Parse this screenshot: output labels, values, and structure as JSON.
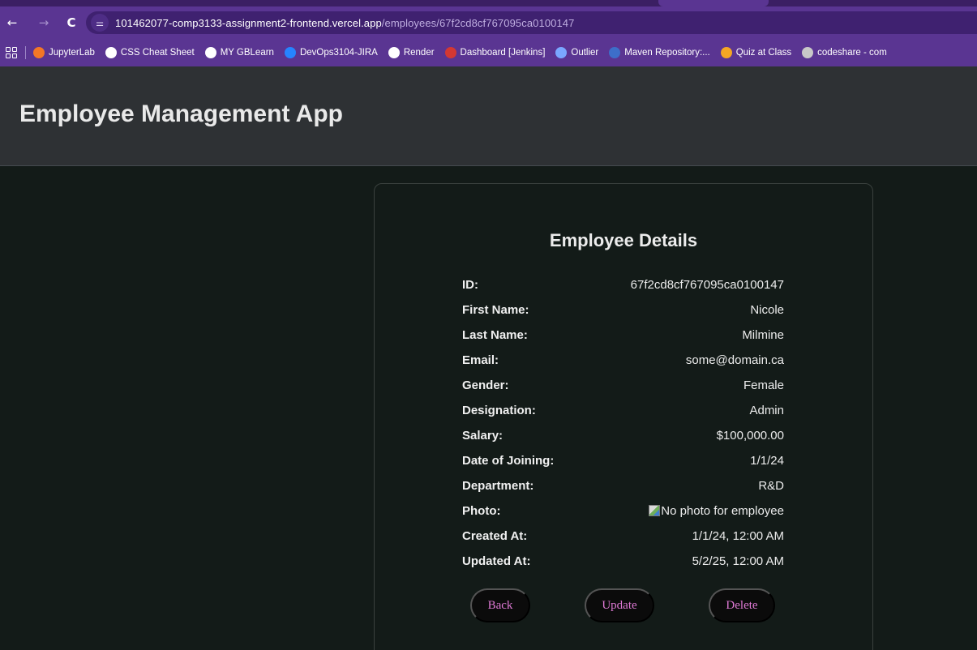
{
  "browser": {
    "url_host": "101462077-comp3133-assignment2-frontend.vercel.app",
    "url_path": "/employees/67f2cd8cf767095ca0100147",
    "bookmarks": [
      {
        "label": "JupyterLab",
        "color": "#f37726"
      },
      {
        "label": "CSS Cheat Sheet",
        "color": "#ffffff"
      },
      {
        "label": "MY GBLearn",
        "color": "#ffffff"
      },
      {
        "label": "DevOps3104-JIRA",
        "color": "#2684ff"
      },
      {
        "label": "Render",
        "color": "#ffffff"
      },
      {
        "label": "Dashboard [Jenkins]",
        "color": "#d33833"
      },
      {
        "label": "Outlier",
        "color": "#7aa7ff"
      },
      {
        "label": "Maven Repository:...",
        "color": "#3d6ec9"
      },
      {
        "label": "Quiz at Class",
        "color": "#f5a623"
      },
      {
        "label": "codeshare - com",
        "color": "#c8c8c8"
      }
    ]
  },
  "app": {
    "title": "Employee Management App"
  },
  "details": {
    "title": "Employee Details",
    "rows": [
      {
        "label": "ID:",
        "value": "67f2cd8cf767095ca0100147"
      },
      {
        "label": "First Name:",
        "value": "Nicole"
      },
      {
        "label": "Last Name:",
        "value": "Milmine"
      },
      {
        "label": "Email:",
        "value": "some@domain.ca"
      },
      {
        "label": "Gender:",
        "value": "Female"
      },
      {
        "label": "Designation:",
        "value": "Admin"
      },
      {
        "label": "Salary:",
        "value": "$100,000.00"
      },
      {
        "label": "Date of Joining:",
        "value": "1/1/24"
      },
      {
        "label": "Department:",
        "value": "R&D"
      },
      {
        "label": "Photo:",
        "value": "No photo for employee"
      },
      {
        "label": "Created At:",
        "value": "1/1/24, 12:00 AM"
      },
      {
        "label": "Updated At:",
        "value": "5/2/25, 12:00 AM"
      }
    ],
    "buttons": {
      "back": "Back",
      "update": "Update",
      "delete": "Delete"
    }
  }
}
